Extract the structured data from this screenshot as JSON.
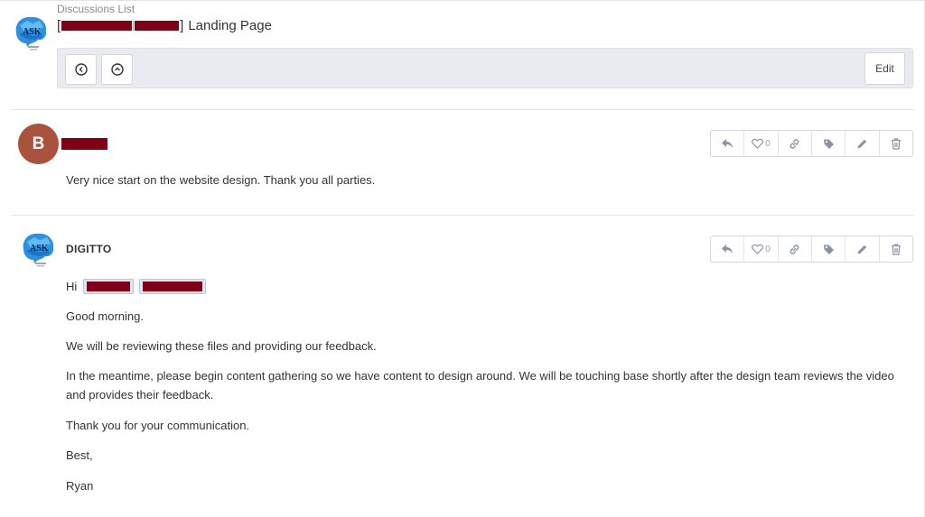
{
  "header": {
    "breadcrumb": "Discussions List",
    "bracket_open": "[",
    "bracket_close": "]",
    "title_suffix": "Landing Page",
    "edit_label": "Edit"
  },
  "icons": {
    "logo": "ask-brain-logo-icon",
    "back": "circle-chevron-left-icon",
    "up": "circle-chevron-up-icon",
    "reply": "reply-icon",
    "like": "heart-outline-icon",
    "link": "link-icon",
    "tag": "tag-icon",
    "edit": "pencil-icon",
    "delete": "trash-icon"
  },
  "colors": {
    "avatar_b": "#a9533f",
    "redaction": "#800018",
    "toolbar_bg": "#e9ebf0",
    "icon": "#8a94a6"
  },
  "comments": [
    {
      "avatar_letter": "B",
      "author": "",
      "likes": "0",
      "body": [
        "Very nice start on the website design. Thank you all parties."
      ]
    },
    {
      "avatar_logo_text": "ASK",
      "author": "DIGITTO",
      "likes": "0",
      "greeting": "Hi",
      "body": [
        "Good morning.",
        "We will be reviewing these files and providing our feedback.",
        "In the meantime, please begin content gathering so we have content to design around. We will be touching base shortly after the design team reviews the video and provides their feedback.",
        "Thank you for your communication.",
        "Best,",
        "Ryan"
      ]
    }
  ]
}
